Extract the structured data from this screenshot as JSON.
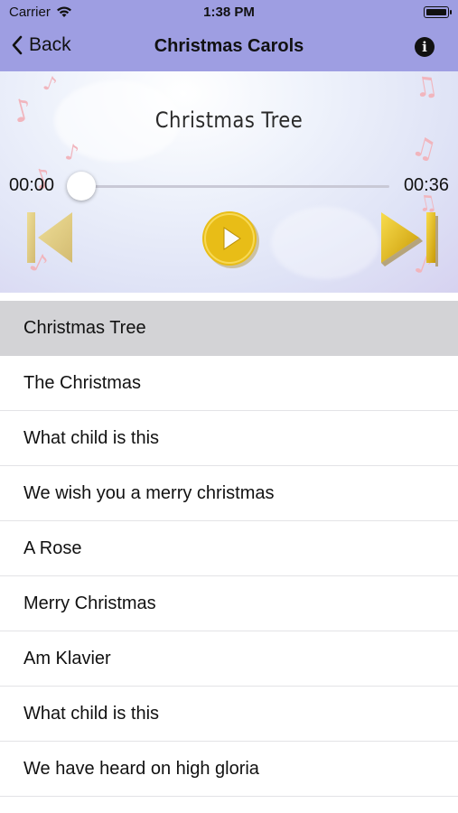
{
  "status_bar": {
    "carrier": "Carrier",
    "time": "1:38 PM"
  },
  "nav": {
    "back_label": "Back",
    "title": "Christmas Carols",
    "info_icon": "i"
  },
  "player": {
    "song_title": "Christmas Tree",
    "current_time": "00:00",
    "duration": "00:36",
    "progress": 0,
    "accent_color": "#e8bd17"
  },
  "songs": [
    {
      "title": "Christmas Tree",
      "selected": true
    },
    {
      "title": "The Christmas"
    },
    {
      "title": "What child is this"
    },
    {
      "title": "We wish you a merry christmas"
    },
    {
      "title": "A Rose"
    },
    {
      "title": "Merry Christmas"
    },
    {
      "title": "Am Klavier"
    },
    {
      "title": "What child is this"
    },
    {
      "title": "We have heard on high gloria"
    }
  ]
}
